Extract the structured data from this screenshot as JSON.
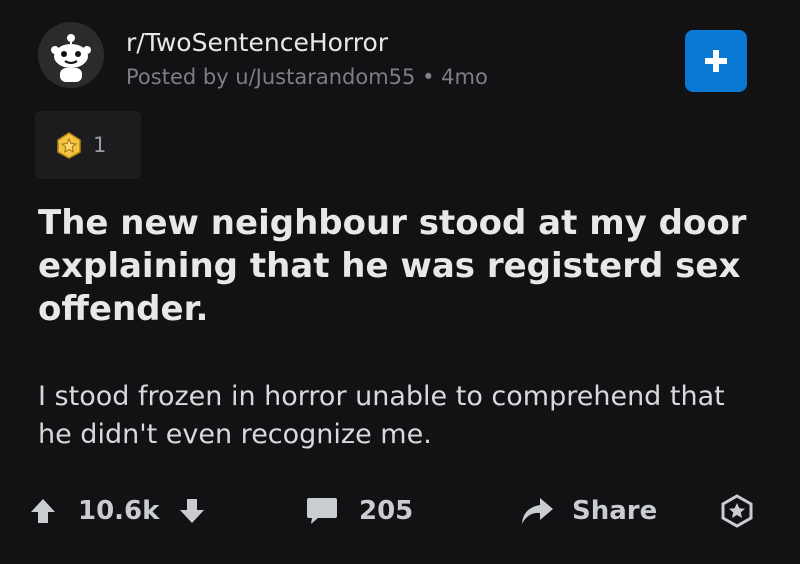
{
  "post": {
    "subreddit": "r/TwoSentenceHorror",
    "posted_by": "Posted by u/Justarandom55 • 4mo",
    "award_count": "1",
    "title": "The new neighbour stood at my door explaining that he was registerd sex offender.",
    "body": "I stood frozen in horror unable to comprehend that he didn't even recognize me."
  },
  "actions": {
    "score": "10.6k",
    "comments": "205",
    "share_label": "Share"
  },
  "colors": {
    "background": "#121214",
    "join_button": "#0a79d3",
    "award": "#f5c542"
  }
}
